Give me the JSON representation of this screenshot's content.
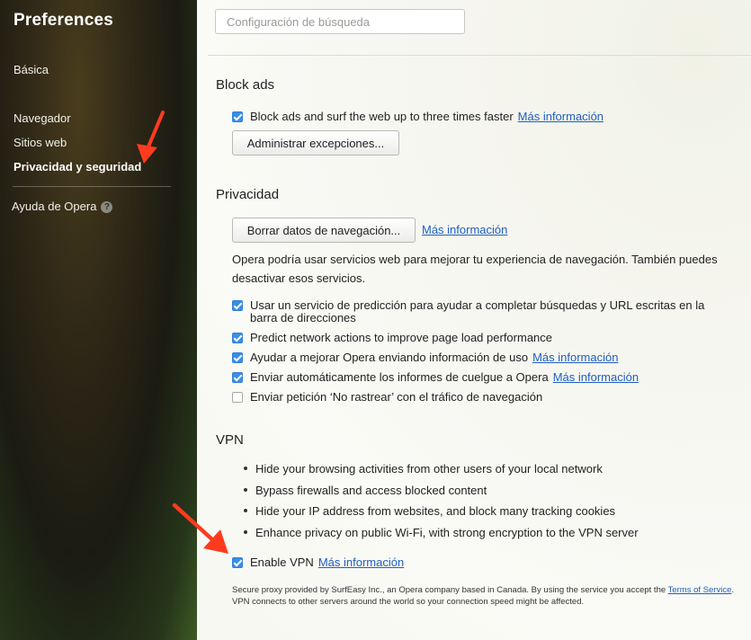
{
  "sidebar": {
    "title": "Preferences",
    "items": [
      {
        "label": "Básica"
      },
      {
        "label": "Navegador"
      },
      {
        "label": "Sitios web"
      },
      {
        "label": "Privacidad y seguridad"
      }
    ],
    "help_label": "Ayuda de Opera",
    "help_badge": "?"
  },
  "search": {
    "placeholder": "Configuración de búsqueda",
    "value": ""
  },
  "more_info": "Más información",
  "block_ads": {
    "title": "Block ads",
    "checkbox_label": "Block ads and surf the web up to three times faster",
    "checked": true,
    "exceptions_button": "Administrar excepciones..."
  },
  "privacy": {
    "title": "Privacidad",
    "clear_button": "Borrar datos de navegación...",
    "description": "Opera podría usar servicios web para mejorar tu experiencia de navegación. También puedes desactivar esos servicios.",
    "options": [
      {
        "label_line1": "Usar un servicio de predicción para ayudar a completar búsquedas y URL escritas en la",
        "label_line2": "barra de direcciones",
        "checked": true
      },
      {
        "label": "Predict network actions to improve page load performance",
        "checked": true
      },
      {
        "label": "Ayudar a mejorar Opera enviando información de uso",
        "checked": true,
        "link": "Más información"
      },
      {
        "label": "Enviar automáticamente los informes de cuelgue a Opera",
        "checked": true,
        "link": "Más información"
      },
      {
        "label": "Enviar petición ‘No rastrear’ con el tráfico de navegación",
        "checked": false
      }
    ]
  },
  "vpn": {
    "title": "VPN",
    "bullets": [
      "Hide your browsing activities from other users of your local network",
      "Bypass firewalls and access blocked content",
      "Hide your IP address from websites, and block many tracking cookies",
      "Enhance privacy on public Wi-Fi, with strong encryption to the VPN server"
    ],
    "enable_label": "Enable VPN",
    "enabled": true,
    "footer_text1": "Secure proxy provided by SurfEasy Inc., an Opera company based in Canada. By using the service you accept the",
    "footer_link": "Terms of Service",
    "footer_period": ".",
    "footer_text2": "VPN connects to other servers around the world so your connection speed might be affected."
  },
  "colors": {
    "accent": "#3a8ee6",
    "link": "#1f5fbf",
    "annotation_arrow": "#ff3b1f"
  }
}
